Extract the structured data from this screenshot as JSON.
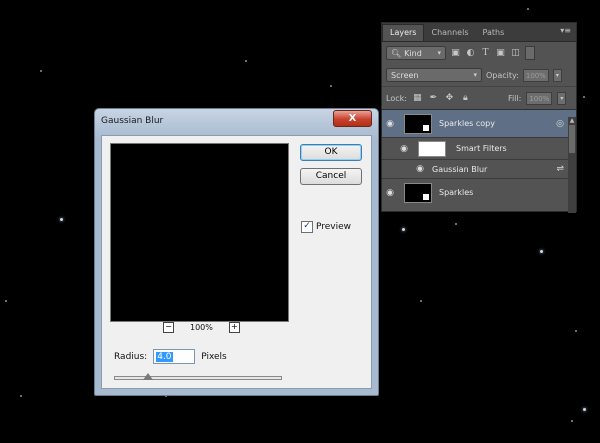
{
  "layers_panel": {
    "tabs": [
      "Layers",
      "Channels",
      "Paths"
    ],
    "menu_glyph": "▾≡",
    "filter_kind": "Kind",
    "filter_icons": [
      "image-filter-icon",
      "adjustment-filter-icon",
      "type-filter-icon",
      "shape-filter-icon",
      "smart-object-filter-icon"
    ],
    "blend_mode": "Screen",
    "opacity_label": "Opacity:",
    "opacity_value": "100%",
    "lock_label": "Lock:",
    "fill_label": "Fill:",
    "fill_value": "100%",
    "layers": [
      {
        "name": "Sparkles copy",
        "selected": true,
        "type": "smart-object"
      },
      {
        "name": "Smart Filters",
        "type": "smart-filters"
      },
      {
        "name": "Gaussian Blur",
        "type": "filter"
      },
      {
        "name": "Sparkles",
        "selected": false,
        "type": "smart-object"
      }
    ]
  },
  "dialog": {
    "title": "Gaussian Blur",
    "close_glyph": "X",
    "ok_label": "OK",
    "cancel_label": "Cancel",
    "preview_label": "Preview",
    "preview_checked": true,
    "zoom_level": "100%",
    "zoom_out_glyph": "−",
    "zoom_in_glyph": "+",
    "radius_label": "Radius:",
    "radius_value": "4.0",
    "radius_units": "Pixels",
    "radius_slider_fraction": 0.2
  },
  "colors": {
    "selected_layer": "#5f6f86",
    "close_button": "#c8412c",
    "panel_bg": "#535353"
  }
}
